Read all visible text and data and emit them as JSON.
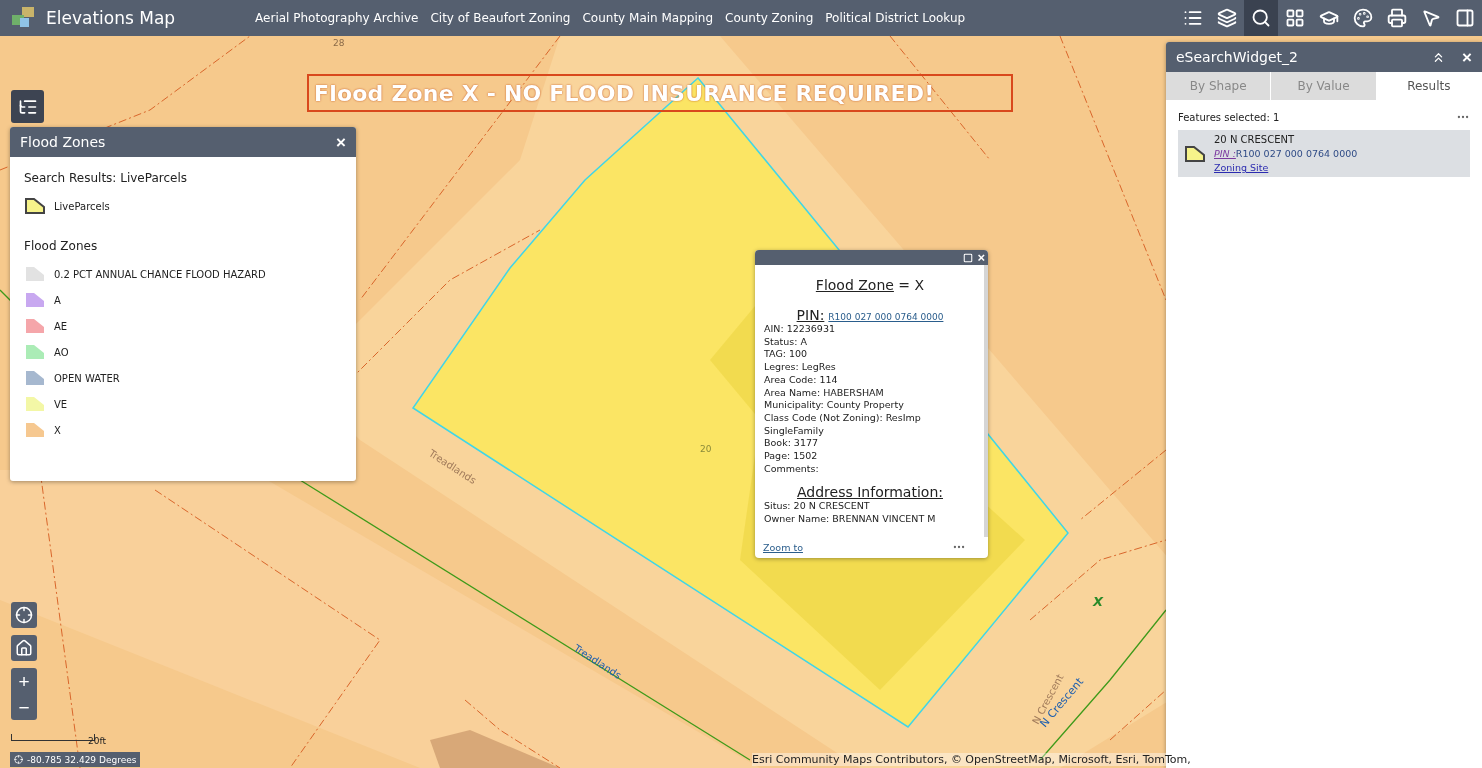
{
  "app": {
    "title": "Elevations Map",
    "nav_links": [
      "Aerial Photography Archive",
      "City of Beaufort Zoning",
      "County Main Mapping",
      "County Zoning",
      "Political District Lookup"
    ]
  },
  "toolbar": [
    {
      "kind": "list",
      "selected": false
    },
    {
      "kind": "layers",
      "selected": false
    },
    {
      "kind": "search",
      "selected": true
    },
    {
      "kind": "grid",
      "selected": false
    },
    {
      "kind": "cap",
      "selected": false
    },
    {
      "kind": "palette",
      "selected": false
    },
    {
      "kind": "print",
      "selected": false
    },
    {
      "kind": "select",
      "selected": false
    },
    {
      "kind": "panel",
      "selected": false
    }
  ],
  "banner": "Flood Zone X - NO FLOOD INSURANCE REQUIRED!",
  "map_labels": [
    {
      "kind": "lot",
      "text": "28"
    },
    {
      "kind": "lot",
      "text": "20"
    },
    {
      "kind": "street-faint",
      "text": "Treadlands"
    },
    {
      "kind": "street",
      "text": "Treadlands"
    },
    {
      "kind": "street-faint2",
      "text": "N Crescent"
    },
    {
      "kind": "street2",
      "text": "N Crescent"
    },
    {
      "kind": "zone",
      "text": "X"
    }
  ],
  "legend_panel": {
    "title": "Flood Zones",
    "close": "×",
    "search_heading": "Search Results: LiveParcels",
    "search_items": [
      {
        "label": "LiveParcels",
        "color": "#f6f38a"
      }
    ],
    "zones_heading": "Flood Zones",
    "zones": [
      {
        "label": "0.2 PCT ANNUAL CHANCE FLOOD HAZARD",
        "color": "#e2e2e2"
      },
      {
        "label": "A",
        "color": "#c8a8f0"
      },
      {
        "label": "AE",
        "color": "#f5a6aa"
      },
      {
        "label": "AO",
        "color": "#abecb6"
      },
      {
        "label": "OPEN WATER",
        "color": "#a6b8cf"
      },
      {
        "label": "VE",
        "color": "#f3f7a6"
      },
      {
        "label": "X",
        "color": "#f6c890"
      }
    ]
  },
  "popup": {
    "title_label": "Flood Zone",
    "title_value": " = X",
    "pin_label": "PIN:",
    "pin_value": "R100 027 000 0764 0000",
    "fields": [
      "AIN: 12236931",
      "Status: A",
      "TAG: 100",
      "Legres: LegRes",
      "Area Code: 114",
      "Area Name: HABERSHAM",
      "Municipality: County Property",
      "Class Code (Not Zoning): ResImp",
      "SingleFamily",
      "Book: 3177",
      "Page: 1502",
      "Comments:"
    ],
    "address_heading": "Address Information:",
    "address_fields": [
      "Situs: 20 N CRESCENT",
      "Owner Name: BRENNAN VINCENT M"
    ],
    "zoom_link": "Zoom to",
    "close": "×"
  },
  "search_widget": {
    "title": "eSearchWidget_2",
    "close": "×",
    "tabs": [
      {
        "label": "By Shape",
        "selected": false
      },
      {
        "label": "By Value",
        "selected": false
      },
      {
        "label": "Results",
        "selected": true
      }
    ],
    "features_selected": "Features selected: 1",
    "result": {
      "name": "20 N CRESCENT",
      "pin_label": "PIN :",
      "pin_value": "R100 027 000 0764 0000",
      "link": "Zoning Site"
    }
  },
  "map_controls": {
    "zoom_in": "+",
    "zoom_out": "−"
  },
  "scale": "20ft",
  "coordinates": "-80.785 32.429 Degrees",
  "attribution": "Esri Community Maps Contributors, © OpenStreetMap, Microsoft, Esri, TomTom,"
}
